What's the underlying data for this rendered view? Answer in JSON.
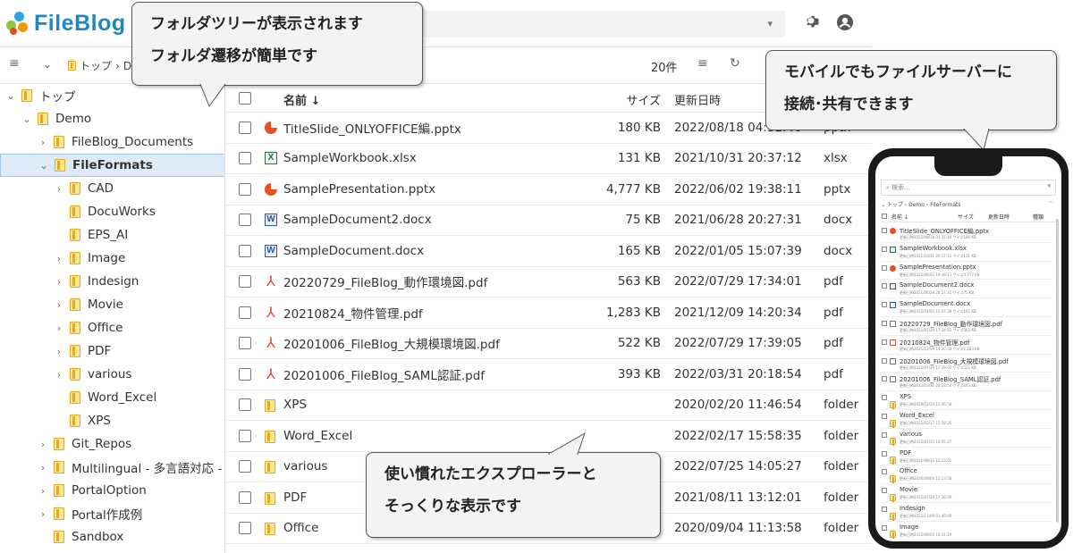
{
  "header": {
    "brand": "FileBlog",
    "logo_colors": [
      "#2ea6e0",
      "#8dc63f",
      "#f39800",
      "#e84e1b"
    ],
    "search_caret": "▾",
    "settings_icon": "gear-icon",
    "user_icon": "user-circle-icon"
  },
  "toolbar": {
    "breadcrumb_root": "トップ",
    "breadcrumb_sep": "›",
    "breadcrumb_more": "D",
    "count": "20件"
  },
  "tree": [
    {
      "label": "トップ",
      "level": 0,
      "chevron": "⌄"
    },
    {
      "label": "Demo",
      "level": 1,
      "chevron": "⌄"
    },
    {
      "label": "FileBlog_Documents",
      "level": 2,
      "chevron": "›"
    },
    {
      "label": "FileFormats",
      "level": 2,
      "chevron": "⌄",
      "selected": true
    },
    {
      "label": "CAD",
      "level": 3,
      "chevron": "›"
    },
    {
      "label": "DocuWorks",
      "level": 3,
      "chevron": ""
    },
    {
      "label": "EPS_AI",
      "level": 3,
      "chevron": ""
    },
    {
      "label": "Image",
      "level": 3,
      "chevron": "›"
    },
    {
      "label": "Indesign",
      "level": 3,
      "chevron": "›"
    },
    {
      "label": "Movie",
      "level": 3,
      "chevron": "›"
    },
    {
      "label": "Office",
      "level": 3,
      "chevron": "›"
    },
    {
      "label": "PDF",
      "level": 3,
      "chevron": "›"
    },
    {
      "label": "various",
      "level": 3,
      "chevron": "›"
    },
    {
      "label": "Word_Excel",
      "level": 3,
      "chevron": ""
    },
    {
      "label": "XPS",
      "level": 3,
      "chevron": ""
    },
    {
      "label": "Git_Repos",
      "level": 2,
      "chevron": "›"
    },
    {
      "label": "Multilingual - 多言語対応 -",
      "level": 2,
      "chevron": "›"
    },
    {
      "label": "PortalOption",
      "level": 2,
      "chevron": "›"
    },
    {
      "label": "Portal作成例",
      "level": 2,
      "chevron": "›"
    },
    {
      "label": "Sandbox",
      "level": 2,
      "chevron": ""
    }
  ],
  "list": {
    "headers": {
      "name": "名前 ↓",
      "size": "サイズ",
      "date": "更新日時"
    },
    "rows": [
      {
        "icon": "ppt",
        "name": "TitleSlide_ONLYOFFICE編.pptx",
        "size": "180 KB",
        "date": "2022/08/18 04:31:40",
        "type": "pptx"
      },
      {
        "icon": "xls",
        "name": "SampleWorkbook.xlsx",
        "size": "131 KB",
        "date": "2021/10/31 20:37:12",
        "type": "xlsx"
      },
      {
        "icon": "ppt",
        "name": "SamplePresentation.pptx",
        "size": "4,777 KB",
        "date": "2022/06/02 19:38:11",
        "type": "pptx"
      },
      {
        "icon": "doc",
        "name": "SampleDocument2.docx",
        "size": "75 KB",
        "date": "2021/06/28 20:27:31",
        "type": "docx"
      },
      {
        "icon": "doc",
        "name": "SampleDocument.docx",
        "size": "165 KB",
        "date": "2022/01/05 15:07:39",
        "type": "docx"
      },
      {
        "icon": "pdf",
        "name": "20220729_FileBlog_動作環境図.pdf",
        "size": "563 KB",
        "date": "2022/07/29 17:34:01",
        "type": "pdf"
      },
      {
        "icon": "pdf",
        "name": "20210824_物件管理.pdf",
        "size": "1,283 KB",
        "date": "2021/12/09 14:20:34",
        "type": "pdf"
      },
      {
        "icon": "pdf",
        "name": "20201006_FileBlog_大規模環境図.pdf",
        "size": "522 KB",
        "date": "2022/07/29 17:39:05",
        "type": "pdf"
      },
      {
        "icon": "pdf",
        "name": "20201006_FileBlog_SAML認証.pdf",
        "size": "393 KB",
        "date": "2022/03/31 20:18:54",
        "type": "pdf"
      },
      {
        "icon": "folder",
        "name": "XPS",
        "size": "",
        "date": "2020/02/20 11:46:54",
        "type": "folder"
      },
      {
        "icon": "folder",
        "name": "Word_Excel",
        "size": "",
        "date": "2022/02/17 15:58:35",
        "type": "folder"
      },
      {
        "icon": "folder",
        "name": "various",
        "size": "",
        "date": "2022/07/25 14:05:27",
        "type": "folder"
      },
      {
        "icon": "folder",
        "name": "PDF",
        "size": "",
        "date": "2021/08/11 13:12:01",
        "type": "folder"
      },
      {
        "icon": "folder",
        "name": "Office",
        "size": "",
        "date": "2020/09/04 11:13:58",
        "type": "folder"
      }
    ]
  },
  "callouts": {
    "tree": [
      "フォルダツリーが表示されます",
      "フォルダ遷移が簡単です"
    ],
    "mobile": [
      "モバイルでもファイルサーバーに",
      "接続･共有できます"
    ],
    "explorer": [
      "使い慣れたエクスプローラーと",
      "そっくりな表示です"
    ]
  },
  "mobile": {
    "search_placeholder": "検索...",
    "search_caret": "▾",
    "menu_dots": "⋯",
    "breadcrumb": "⌄ トップ › Demo › FileFormats",
    "headers": {
      "name": "名前 ↓",
      "size": "サイズ",
      "date": "更新日時",
      "type": "種類"
    },
    "rows": [
      {
        "icon": "ppt",
        "name": "TitleSlide_ONLYOFFICE編.pptx",
        "meta": "更新日時2022/08/18 04:31:40 サイズ180 KB"
      },
      {
        "icon": "xls",
        "name": "SampleWorkbook.xlsx",
        "meta": "更新日時2021/10/31 20:37:12 サイズ131 KB"
      },
      {
        "icon": "ppt",
        "name": "SamplePresentation.pptx",
        "meta": "更新日時2022/06/02 19:38:11 サイズ4,777 KB"
      },
      {
        "icon": "doc",
        "name": "SampleDocument2.docx",
        "meta": "更新日時2021/06/28 20:27:31 サイズ75 KB"
      },
      {
        "icon": "doc",
        "name": "SampleDocument.docx",
        "meta": "更新日時2022/01/05 15:07:39 サイズ165 KB"
      },
      {
        "icon": "pdf",
        "name": "20220729_FileBlog_動作環境図.pdf",
        "meta": "更新日時2022/07/29 17:34:01 サイズ563 KB"
      },
      {
        "icon": "pdf",
        "name": "20210824_物件管理.pdf",
        "meta": "更新日時2021/12/09 14:20:34 サイズ1,283 KB"
      },
      {
        "icon": "pdf",
        "name": "20201006_FileBlog_大規模環境図.pdf",
        "meta": "更新日時2022/07/29 17:39:05 サイズ522 KB"
      },
      {
        "icon": "pdf",
        "name": "20201006_FileBlog_SAML認証.pdf",
        "meta": "更新日時2022/03/31 20:18:54 サイズ393 KB"
      },
      {
        "icon": "folder",
        "name": "XPS",
        "meta": "更新日時2020/02/20 11:46:54"
      },
      {
        "icon": "folder",
        "name": "Word_Excel",
        "meta": "更新日時2022/02/17 15:58:35"
      },
      {
        "icon": "folder",
        "name": "various",
        "meta": "更新日時2022/07/25 14:05:27"
      },
      {
        "icon": "folder",
        "name": "PDF",
        "meta": "更新日時2021/08/11 13:12:01"
      },
      {
        "icon": "folder",
        "name": "Office",
        "meta": "更新日時2020/09/04 11:13:58"
      },
      {
        "icon": "folder",
        "name": "Movie",
        "meta": "更新日時2022/07/28 17:36:40"
      },
      {
        "icon": "folder",
        "name": "Indesign",
        "meta": "更新日時2022/11/09 01:49:40"
      },
      {
        "icon": "folder",
        "name": "Image",
        "meta": "更新日時2022/09/05 10:31:29"
      }
    ]
  }
}
